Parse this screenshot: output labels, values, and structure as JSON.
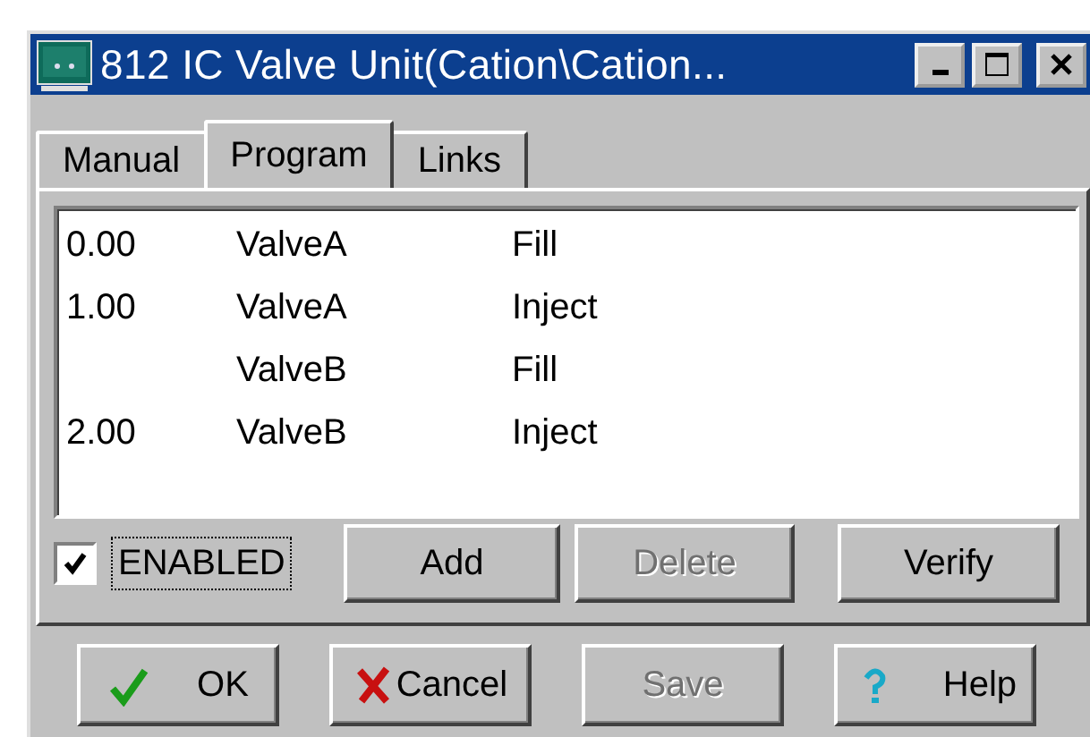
{
  "window": {
    "title": "812 IC Valve Unit(Cation\\Cation..."
  },
  "tabs": [
    {
      "label": "Manual",
      "selected": false
    },
    {
      "label": "Program",
      "selected": true
    },
    {
      "label": "Links",
      "selected": false
    }
  ],
  "program_list": {
    "rows": [
      {
        "column_1": "0.00",
        "column_2": "ValveA",
        "column_3": "Fill"
      },
      {
        "column_1": "1.00",
        "column_2": "ValveA",
        "column_3": "Inject"
      },
      {
        "column_2": "ValveB",
        "column_3": "Fill"
      },
      {
        "column_1": "2.00",
        "column_2": "ValveB",
        "column_3": "Inject"
      }
    ]
  },
  "enabled_checkbox": {
    "label": "ENABLED",
    "checked": true
  },
  "list_buttons": [
    {
      "label": "Add",
      "disabled": false
    },
    {
      "label": "Delete",
      "disabled": true
    },
    {
      "label": "Verify",
      "disabled": false
    }
  ],
  "dialog_buttons": [
    {
      "label": "OK",
      "kind": "ok",
      "disabled": false
    },
    {
      "label": "Cancel",
      "kind": "cancel",
      "disabled": false
    },
    {
      "label": "Save",
      "kind": "plain",
      "disabled": true
    },
    {
      "label": "Help",
      "kind": "help",
      "disabled": false
    }
  ]
}
